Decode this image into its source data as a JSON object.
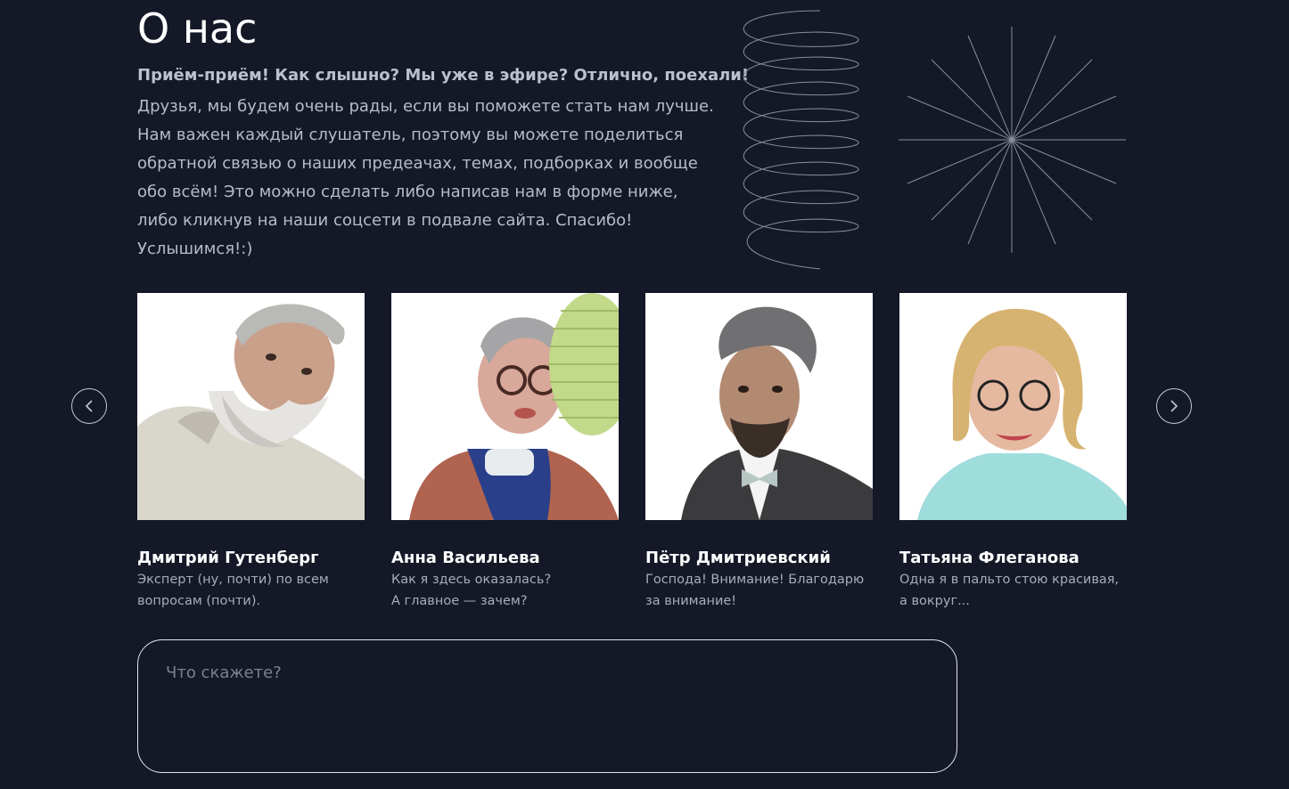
{
  "section": {
    "title": "О нас",
    "lead": "Приём-приём! Как слышно? Мы уже в эфире? Отлично, поехали!",
    "paragraph_lines": [
      "Друзья, мы будем очень рады, если вы поможете стать нам лучше.",
      "Нам важен каждый слушатель, поэтому вы можете поделиться",
      "обратной связью о наших предеачах, темах, подборках и вообще",
      "обо всём! Это можно сделать либо написав нам в форме ниже,",
      "либо кликнув на наши соцсети в подвале сайта. Спасибо!",
      "Услышимся!:)"
    ]
  },
  "carousel": {
    "prev_icon": "chevron-left-icon",
    "next_icon": "chevron-right-icon",
    "hosts": [
      {
        "name": "Дмитрий Гутенберг",
        "desc_lines": [
          "Эксперт (ну, почти) по всем",
          "вопросам (почти)."
        ],
        "photo": "host-photo-bearded-man"
      },
      {
        "name": "Анна Васильева",
        "desc_lines": [
          "Как я здесь оказалась?",
          "А главное — зачем?"
        ],
        "photo": "host-photo-woman-glasses-pearls"
      },
      {
        "name": "Пётр Дмитриевский",
        "desc_lines": [
          "Господа! Внимание! Благодарю",
          "за внимание!"
        ],
        "photo": "host-photo-man-bowtie"
      },
      {
        "name": "Татьяна Флеганова",
        "desc_lines": [
          "Одна я в пальто стою красивая,",
          "а вокруг..."
        ],
        "photo": "host-photo-blonde-woman-glasses"
      }
    ]
  },
  "feedback": {
    "placeholder": "Что скажете?",
    "value": ""
  },
  "colors": {
    "background": "#141827",
    "text_primary": "#ffffff",
    "text_secondary": "#b8bcc8",
    "line_art": "#8a8f9c"
  }
}
